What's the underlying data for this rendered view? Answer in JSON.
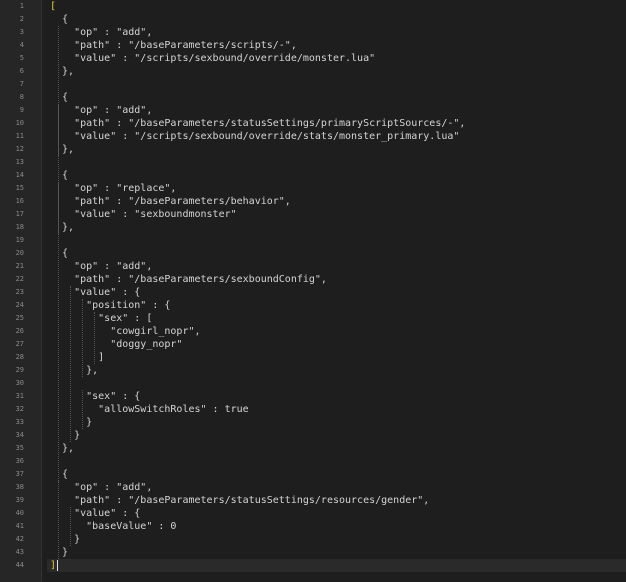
{
  "editor": {
    "lines": [
      {
        "n": "1",
        "text": "[",
        "bracket": true
      },
      {
        "n": "2",
        "text": "  {"
      },
      {
        "n": "3",
        "text": "    \"op\" : \"add\","
      },
      {
        "n": "4",
        "text": "    \"path\" : \"/baseParameters/scripts/-\","
      },
      {
        "n": "5",
        "text": "    \"value\" : \"/scripts/sexbound/override/monster.lua\""
      },
      {
        "n": "6",
        "text": "  },"
      },
      {
        "n": "7",
        "text": ""
      },
      {
        "n": "8",
        "text": "  {"
      },
      {
        "n": "9",
        "text": "    \"op\" : \"add\","
      },
      {
        "n": "10",
        "text": "    \"path\" : \"/baseParameters/statusSettings/primaryScriptSources/-\","
      },
      {
        "n": "11",
        "text": "    \"value\" : \"/scripts/sexbound/override/stats/monster_primary.lua\""
      },
      {
        "n": "12",
        "text": "  },"
      },
      {
        "n": "13",
        "text": ""
      },
      {
        "n": "14",
        "text": "  {"
      },
      {
        "n": "15",
        "text": "    \"op\" : \"replace\","
      },
      {
        "n": "16",
        "text": "    \"path\" : \"/baseParameters/behavior\","
      },
      {
        "n": "17",
        "text": "    \"value\" : \"sexboundmonster\""
      },
      {
        "n": "18",
        "text": "  },"
      },
      {
        "n": "19",
        "text": ""
      },
      {
        "n": "20",
        "text": "  {"
      },
      {
        "n": "21",
        "text": "    \"op\" : \"add\","
      },
      {
        "n": "22",
        "text": "    \"path\" : \"/baseParameters/sexboundConfig\","
      },
      {
        "n": "23",
        "text": "    \"value\" : {"
      },
      {
        "n": "24",
        "text": "      \"position\" : {"
      },
      {
        "n": "25",
        "text": "        \"sex\" : ["
      },
      {
        "n": "26",
        "text": "          \"cowgirl_nopr\","
      },
      {
        "n": "27",
        "text": "          \"doggy_nopr\""
      },
      {
        "n": "28",
        "text": "        ]"
      },
      {
        "n": "29",
        "text": "      },"
      },
      {
        "n": "30",
        "text": ""
      },
      {
        "n": "31",
        "text": "      \"sex\" : {"
      },
      {
        "n": "32",
        "text": "        \"allowSwitchRoles\" : true"
      },
      {
        "n": "33",
        "text": "      }"
      },
      {
        "n": "34",
        "text": "    }"
      },
      {
        "n": "35",
        "text": "  },"
      },
      {
        "n": "36",
        "text": ""
      },
      {
        "n": "37",
        "text": "  {"
      },
      {
        "n": "38",
        "text": "    \"op\" : \"add\","
      },
      {
        "n": "39",
        "text": "    \"path\" : \"/baseParameters/statusSettings/resources/gender\","
      },
      {
        "n": "40",
        "text": "    \"value\" : {"
      },
      {
        "n": "41",
        "text": "      \"baseValue\" : 0"
      },
      {
        "n": "42",
        "text": "    }"
      },
      {
        "n": "43",
        "text": "  }"
      },
      {
        "n": "44",
        "text": "]",
        "bracket": true,
        "current": true
      }
    ]
  },
  "colors": {
    "background": "#1e1e1e",
    "text": "#d4d4d4",
    "line_number": "#8a8a8a",
    "matched_bracket": "#e8c841"
  }
}
